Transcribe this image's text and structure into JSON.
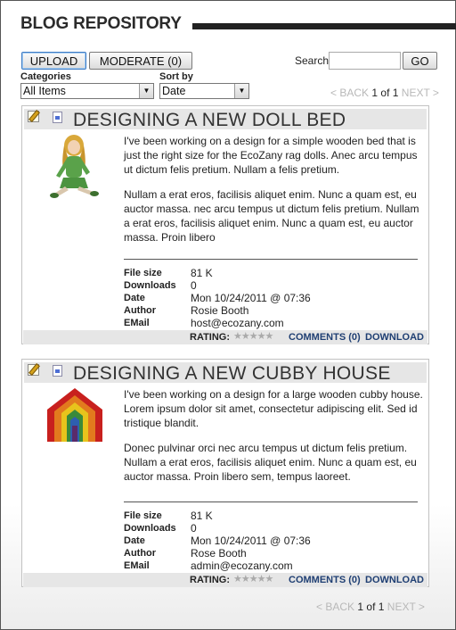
{
  "header": {
    "title": "BLOG REPOSITORY"
  },
  "toolbar": {
    "upload_label": "UPLOAD",
    "moderate_label": "MODERATE (0)",
    "search_label": "Search",
    "search_value": "",
    "go_label": "GO"
  },
  "filters": {
    "categories_label": "Categories",
    "categories_value": "All Items",
    "sort_label": "Sort by",
    "sort_value": "Date"
  },
  "pager": {
    "back": "< BACK",
    "page": "1",
    "of": "of",
    "total": "1",
    "next": "NEXT >"
  },
  "posts": [
    {
      "title": "DESIGNING A NEW DOLL BED",
      "paragraph1": "I've been working on a design for a simple wooden bed that is just the right size for the EcoZany rag dolls. Anec arcu tempus ut dictum felis pretium. Nullam a felis pretium.",
      "paragraph2": "Nullam a erat eros, facilisis aliquet enim. Nunc a quam est, eu auctor massa. nec arcu tempus ut dictum felis pretium. Nullam a erat eros, facilisis aliquet enim. Nunc a quam est, eu auctor massa. Proin libero",
      "meta": {
        "file_size_label": "File size",
        "file_size": "81 K",
        "downloads_label": "Downloads",
        "downloads": "0",
        "date_label": "Date",
        "date": "Mon 10/24/2011 @ 07:36",
        "author_label": "Author",
        "author": "Rosie Booth",
        "email_label": "EMail",
        "email": "host@ecozany.com"
      },
      "rating_label": "RATING:",
      "rating_stars": "★★★★★",
      "comments": "COMMENTS (0)",
      "download": "DOWNLOAD"
    },
    {
      "title": "DESIGNING A NEW CUBBY HOUSE",
      "paragraph1": "I've been working on a design for a large wooden cubby house. Lorem ipsum dolor sit amet, consectetur adipiscing elit. Sed id tristique blandit.",
      "paragraph2": "Donec pulvinar orci nec arcu tempus ut dictum felis pretium. Nullam a erat eros, facilisis aliquet enim. Nunc a quam est, eu auctor massa. Proin libero sem, tempus laoreet.",
      "meta": {
        "file_size_label": "File size",
        "file_size": "81 K",
        "downloads_label": "Downloads",
        "downloads": "0",
        "date_label": "Date",
        "date": "Mon 10/24/2011 @ 07:36",
        "author_label": "Author",
        "author": "Rose Booth",
        "email_label": "EMail",
        "email": "admin@ecozany.com"
      },
      "rating_label": "RATING:",
      "rating_stars": "★★★★★",
      "comments": "COMMENTS (0)",
      "download": "DOWNLOAD"
    }
  ]
}
